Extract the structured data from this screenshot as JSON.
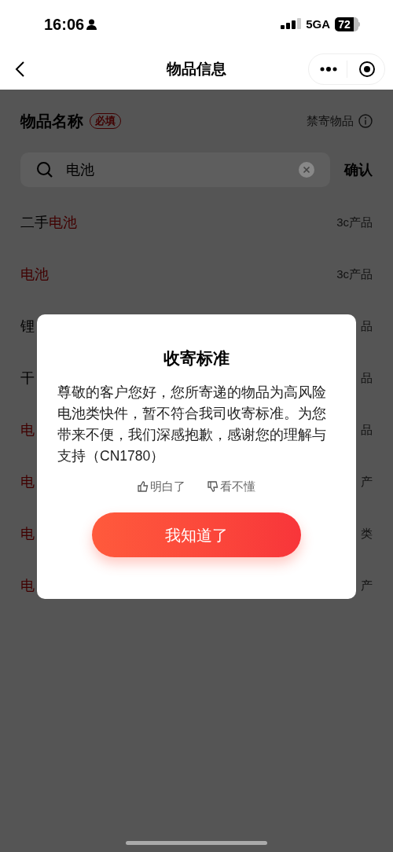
{
  "status_bar": {
    "time": "16:06",
    "network": "5GA",
    "battery": "72"
  },
  "nav": {
    "title": "物品信息"
  },
  "field": {
    "label": "物品名称",
    "badge": "必填",
    "link": "禁寄物品"
  },
  "search": {
    "value": "电池",
    "confirm": "确认"
  },
  "results": [
    {
      "name": [
        {
          "text": "二手",
          "highlight": false
        },
        {
          "text": "电池",
          "highlight": true
        }
      ],
      "category": "3c产品"
    },
    {
      "name": [
        {
          "text": "电池",
          "highlight": true
        }
      ],
      "category": "3c产品"
    },
    {
      "name": [
        {
          "text": "锂",
          "highlight": false
        }
      ],
      "category": "品"
    },
    {
      "name": [
        {
          "text": "干",
          "highlight": false
        }
      ],
      "category": "品"
    },
    {
      "name": [
        {
          "text": "电",
          "highlight": true
        }
      ],
      "category": "品"
    },
    {
      "name": [
        {
          "text": "电",
          "highlight": true
        }
      ],
      "category": "产"
    },
    {
      "name": [
        {
          "text": "电",
          "highlight": true
        }
      ],
      "category": "类"
    },
    {
      "name": [
        {
          "text": "电",
          "highlight": true
        }
      ],
      "category": "产"
    }
  ],
  "dialog": {
    "title": "收寄标准",
    "message": "尊敬的客户您好，您所寄递的物品为高风险电池类快件，暂不符合我司收寄标准。为您带来不便，我们深感抱歉，感谢您的理解与支持（CN1780）",
    "feedback": [
      "明白了",
      "看不懂"
    ],
    "button": "我知道了"
  }
}
